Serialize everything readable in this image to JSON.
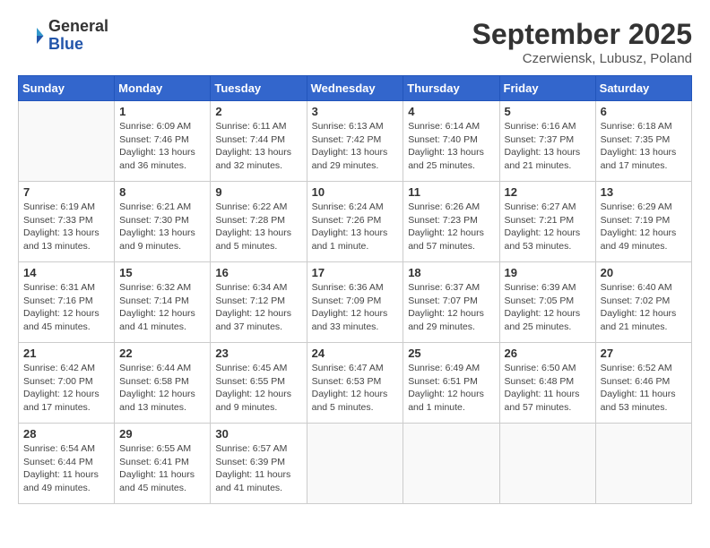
{
  "header": {
    "logo_line1": "General",
    "logo_line2": "Blue",
    "month": "September 2025",
    "location": "Czerwiensk, Lubusz, Poland"
  },
  "weekdays": [
    "Sunday",
    "Monday",
    "Tuesday",
    "Wednesday",
    "Thursday",
    "Friday",
    "Saturday"
  ],
  "weeks": [
    [
      {
        "day": "",
        "info": ""
      },
      {
        "day": "1",
        "info": "Sunrise: 6:09 AM\nSunset: 7:46 PM\nDaylight: 13 hours\nand 36 minutes."
      },
      {
        "day": "2",
        "info": "Sunrise: 6:11 AM\nSunset: 7:44 PM\nDaylight: 13 hours\nand 32 minutes."
      },
      {
        "day": "3",
        "info": "Sunrise: 6:13 AM\nSunset: 7:42 PM\nDaylight: 13 hours\nand 29 minutes."
      },
      {
        "day": "4",
        "info": "Sunrise: 6:14 AM\nSunset: 7:40 PM\nDaylight: 13 hours\nand 25 minutes."
      },
      {
        "day": "5",
        "info": "Sunrise: 6:16 AM\nSunset: 7:37 PM\nDaylight: 13 hours\nand 21 minutes."
      },
      {
        "day": "6",
        "info": "Sunrise: 6:18 AM\nSunset: 7:35 PM\nDaylight: 13 hours\nand 17 minutes."
      }
    ],
    [
      {
        "day": "7",
        "info": "Sunrise: 6:19 AM\nSunset: 7:33 PM\nDaylight: 13 hours\nand 13 minutes."
      },
      {
        "day": "8",
        "info": "Sunrise: 6:21 AM\nSunset: 7:30 PM\nDaylight: 13 hours\nand 9 minutes."
      },
      {
        "day": "9",
        "info": "Sunrise: 6:22 AM\nSunset: 7:28 PM\nDaylight: 13 hours\nand 5 minutes."
      },
      {
        "day": "10",
        "info": "Sunrise: 6:24 AM\nSunset: 7:26 PM\nDaylight: 13 hours\nand 1 minute."
      },
      {
        "day": "11",
        "info": "Sunrise: 6:26 AM\nSunset: 7:23 PM\nDaylight: 12 hours\nand 57 minutes."
      },
      {
        "day": "12",
        "info": "Sunrise: 6:27 AM\nSunset: 7:21 PM\nDaylight: 12 hours\nand 53 minutes."
      },
      {
        "day": "13",
        "info": "Sunrise: 6:29 AM\nSunset: 7:19 PM\nDaylight: 12 hours\nand 49 minutes."
      }
    ],
    [
      {
        "day": "14",
        "info": "Sunrise: 6:31 AM\nSunset: 7:16 PM\nDaylight: 12 hours\nand 45 minutes."
      },
      {
        "day": "15",
        "info": "Sunrise: 6:32 AM\nSunset: 7:14 PM\nDaylight: 12 hours\nand 41 minutes."
      },
      {
        "day": "16",
        "info": "Sunrise: 6:34 AM\nSunset: 7:12 PM\nDaylight: 12 hours\nand 37 minutes."
      },
      {
        "day": "17",
        "info": "Sunrise: 6:36 AM\nSunset: 7:09 PM\nDaylight: 12 hours\nand 33 minutes."
      },
      {
        "day": "18",
        "info": "Sunrise: 6:37 AM\nSunset: 7:07 PM\nDaylight: 12 hours\nand 29 minutes."
      },
      {
        "day": "19",
        "info": "Sunrise: 6:39 AM\nSunset: 7:05 PM\nDaylight: 12 hours\nand 25 minutes."
      },
      {
        "day": "20",
        "info": "Sunrise: 6:40 AM\nSunset: 7:02 PM\nDaylight: 12 hours\nand 21 minutes."
      }
    ],
    [
      {
        "day": "21",
        "info": "Sunrise: 6:42 AM\nSunset: 7:00 PM\nDaylight: 12 hours\nand 17 minutes."
      },
      {
        "day": "22",
        "info": "Sunrise: 6:44 AM\nSunset: 6:58 PM\nDaylight: 12 hours\nand 13 minutes."
      },
      {
        "day": "23",
        "info": "Sunrise: 6:45 AM\nSunset: 6:55 PM\nDaylight: 12 hours\nand 9 minutes."
      },
      {
        "day": "24",
        "info": "Sunrise: 6:47 AM\nSunset: 6:53 PM\nDaylight: 12 hours\nand 5 minutes."
      },
      {
        "day": "25",
        "info": "Sunrise: 6:49 AM\nSunset: 6:51 PM\nDaylight: 12 hours\nand 1 minute."
      },
      {
        "day": "26",
        "info": "Sunrise: 6:50 AM\nSunset: 6:48 PM\nDaylight: 11 hours\nand 57 minutes."
      },
      {
        "day": "27",
        "info": "Sunrise: 6:52 AM\nSunset: 6:46 PM\nDaylight: 11 hours\nand 53 minutes."
      }
    ],
    [
      {
        "day": "28",
        "info": "Sunrise: 6:54 AM\nSunset: 6:44 PM\nDaylight: 11 hours\nand 49 minutes."
      },
      {
        "day": "29",
        "info": "Sunrise: 6:55 AM\nSunset: 6:41 PM\nDaylight: 11 hours\nand 45 minutes."
      },
      {
        "day": "30",
        "info": "Sunrise: 6:57 AM\nSunset: 6:39 PM\nDaylight: 11 hours\nand 41 minutes."
      },
      {
        "day": "",
        "info": ""
      },
      {
        "day": "",
        "info": ""
      },
      {
        "day": "",
        "info": ""
      },
      {
        "day": "",
        "info": ""
      }
    ]
  ]
}
